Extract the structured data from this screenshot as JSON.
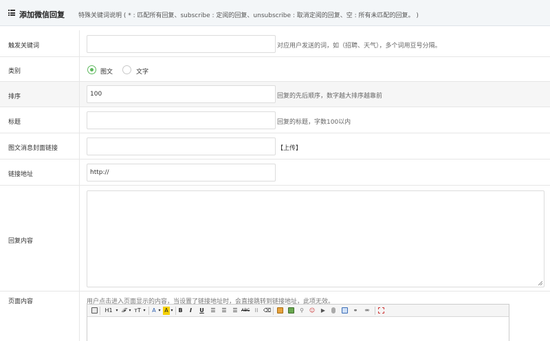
{
  "header": {
    "title": "添加微信回复",
    "description": "特殊关键词说明 ( * : 匹配所有回复、subscribe : 定阅的回复、unsubscribe : 取消定阅的回复、空 : 所有未匹配的回复。 )"
  },
  "form": {
    "keyword": {
      "label": "触发关键词",
      "value": "",
      "hint": "对应用户发送的词，如（招聘、天气），多个词用豆号分隔。"
    },
    "category": {
      "label": "类别",
      "options": [
        "图文",
        "文字"
      ],
      "selected": "图文"
    },
    "sort": {
      "label": "排序",
      "value": "100",
      "hint": "回复的先后顺序，数字越大排序越靠前"
    },
    "title": {
      "label": "标题",
      "value": "",
      "hint": "回复的标题，字数100以内"
    },
    "cover": {
      "label": "图文消息封面链接",
      "value": "",
      "upload_label": "【上传】"
    },
    "link": {
      "label": "链接地址",
      "value": "http://"
    },
    "reply": {
      "label": "回复内容",
      "value": ""
    },
    "page": {
      "label": "页面内容",
      "hint": "用户点击进入页面显示的内容，当设置了链接地址时，会直接跳转到链接地址，此项无效。"
    }
  },
  "editor": {
    "toolbar": {
      "heading": "H1",
      "font_family": "𝓕",
      "font_size": "тT",
      "font_color": "A",
      "highlight": "A",
      "bold": "B",
      "italic": "I",
      "underline": "U",
      "strikethrough": "ABC"
    },
    "colors": {
      "highlight": "#f5d000",
      "accent": "#5cb85c"
    }
  }
}
